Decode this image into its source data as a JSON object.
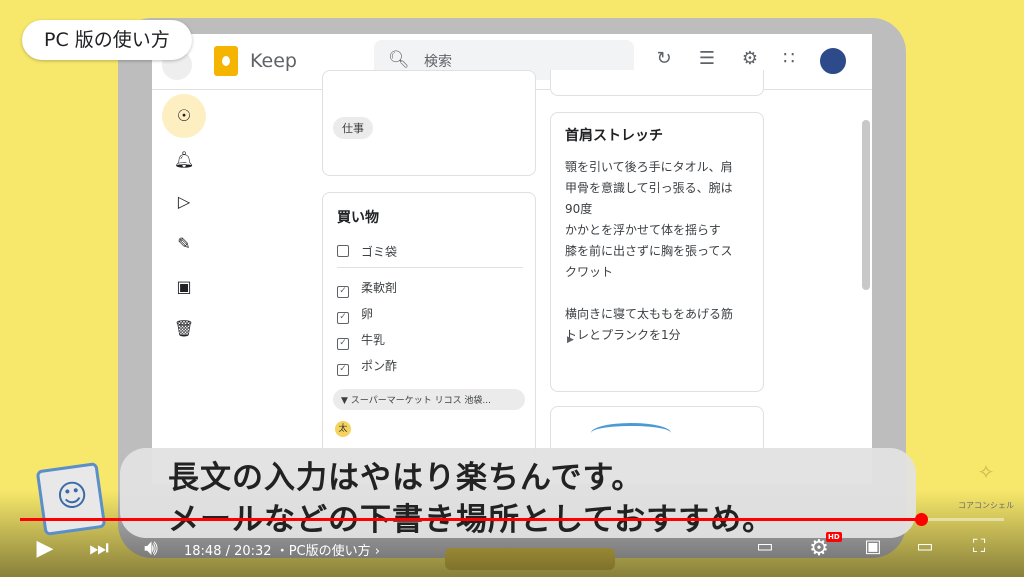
{
  "video": {
    "overlay_tag": "PC 版の使い方",
    "caption_line1": "長文の入力はやはり楽ちんです。",
    "caption_line2": "メールなどの下書き場所としておすすめ。",
    "channel_name": "コアコンシェル",
    "time": "18:48 / 20:32",
    "chapter": "・PC版の使い方 ›",
    "progress_fraction": 0.916,
    "hd_badge": "HD",
    "accent_color": "#ff0000",
    "background_color": "#f7e86b"
  },
  "keep": {
    "app_title": "Keep",
    "search_placeholder": "検索",
    "toolbar_icons": [
      "refresh-icon",
      "list-view-icon",
      "settings-icon",
      "apps-grid-icon"
    ],
    "sidebar_icons": [
      "lightbulb-icon",
      "bell-icon",
      "label-icon",
      "pencil-icon",
      "archive-icon",
      "trash-icon"
    ],
    "notes": {
      "work_label": "仕事",
      "shopping": {
        "title": "買い物",
        "unchecked": [
          "ゴミ袋"
        ],
        "checked": [
          "柔軟剤",
          "卵",
          "牛乳",
          "ポン酢"
        ],
        "location": "スーパーマーケット リコス 池袋...",
        "collaborator": "太"
      },
      "stretch": {
        "title": "首肩ストレッチ",
        "body": "顎を引いて後ろ手にタオル、肩\n甲骨を意識して引っ張る、腕は\n90度\nかかとを浮かせて体を揺らす\n膝を前に出さずに胸を張ってス\nクワット\n\n横向きに寝て太ももをあげる筋\nトレとプランクを1分"
      }
    }
  }
}
